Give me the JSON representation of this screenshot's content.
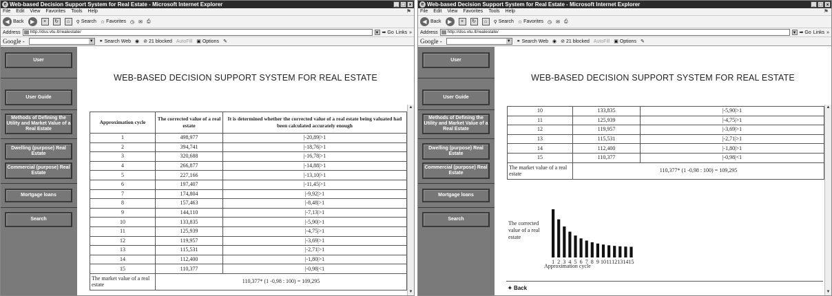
{
  "window": {
    "title": "Web-based Decision Support System for Real Estate - Microsoft Internet Explorer",
    "menu": [
      "File",
      "Edit",
      "View",
      "Favorites",
      "Tools",
      "Help"
    ],
    "toolbar": {
      "back": "Back",
      "search": "Search",
      "favorites": "Favorites"
    },
    "address_label": "Address",
    "address": "http://dss.vtu.lt/realestate/",
    "go": "Go",
    "links": "Links",
    "google_logo": "Google -",
    "search_web": "Search Web",
    "blocked": "21 blocked",
    "autofill": "AutoFill",
    "options": "Options"
  },
  "sidebar": {
    "items": [
      {
        "label": "User"
      },
      {
        "label": "User Guide"
      },
      {
        "label": "Methods of Defining the Utility and Market Value of a Real Estate"
      },
      {
        "label": "Dwelling (purpose) Real Estate"
      },
      {
        "label": "Commercial (purpose) Real Estate"
      },
      {
        "label": "Mortgage loans"
      },
      {
        "label": "Search"
      }
    ]
  },
  "page_title": "WEB-BASED DECISION SUPPORT SYSTEM FOR REAL ESTATE",
  "table": {
    "headers": [
      "Approximation cycle",
      "The corrected value of a real estate",
      "It is determined whether the corrected value of a real estate being valuated had been calculated accurately enough"
    ],
    "rows": [
      [
        "1",
        "498,977",
        "|-20,89|>1"
      ],
      [
        "2",
        "394,741",
        "|-18,76|>1"
      ],
      [
        "3",
        "320,688",
        "|-16,78|>1"
      ],
      [
        "4",
        "266,877",
        "|-14,88|>1"
      ],
      [
        "5",
        "227,166",
        "|-13,10|>1"
      ],
      [
        "6",
        "197,407",
        "|-11,45|>1"
      ],
      [
        "7",
        "174,804",
        "|-9,92|>1"
      ],
      [
        "8",
        "157,463",
        "|-8,48|>1"
      ],
      [
        "9",
        "144,110",
        "|-7,13|>1"
      ],
      [
        "10",
        "133,835",
        "|-5,90|>1"
      ],
      [
        "11",
        "125,939",
        "|-4,75|>1"
      ],
      [
        "12",
        "119,957",
        "|-3,69|>1"
      ],
      [
        "13",
        "115,531",
        "|-2,71|>1"
      ],
      [
        "14",
        "112,400",
        "|-1,80|>1"
      ],
      [
        "15",
        "110,377",
        "|-0,98|<1"
      ]
    ],
    "market_label": "The market value of a real estate",
    "market_formula": "110,377* (1 -0,98 : 100) = 109,295"
  },
  "chart": {
    "ylabel": "The corrected value of a real estate",
    "xlabel": "Approximation cycle",
    "ticks": [
      "1",
      "2",
      "3",
      "4",
      "5",
      "6",
      "7",
      "8",
      "9",
      "10",
      "11",
      "12",
      "13",
      "14",
      "15"
    ]
  },
  "chart_data": {
    "type": "bar",
    "categories": [
      "1",
      "2",
      "3",
      "4",
      "5",
      "6",
      "7",
      "8",
      "9",
      "10",
      "11",
      "12",
      "13",
      "14",
      "15"
    ],
    "values": [
      498977,
      394741,
      320688,
      266877,
      227166,
      197407,
      174804,
      157463,
      144110,
      133835,
      125939,
      119957,
      115531,
      112400,
      110377
    ],
    "title": "",
    "xlabel": "Approximation cycle",
    "ylabel": "The corrected value of a real estate"
  },
  "back_link": "Back"
}
